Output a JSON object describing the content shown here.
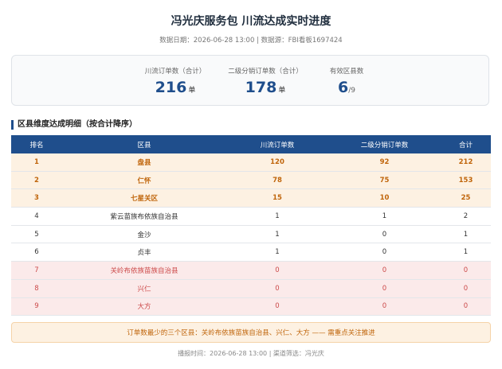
{
  "header": {
    "title": "冯光庆服务包 川流达成实时进度",
    "meta": "数据日期：2026-06-28 13:00 | 数据源：FBI看板1697424"
  },
  "summary": {
    "total_orders": {
      "label": "川流订单数（合计）",
      "value": "216",
      "unit": "单"
    },
    "sub_orders": {
      "label": "二级分销订单数（合计）",
      "value": "178",
      "unit": "单"
    },
    "districts": {
      "label": "有效区县数",
      "value": "6",
      "suffix": "/9"
    }
  },
  "section_title": "区县维度达成明细（按合计降序）",
  "table": {
    "headers": [
      "排名",
      "区县",
      "川流订单数",
      "二级分销订单数",
      "合计"
    ],
    "rows": [
      {
        "rank": "1",
        "district": "盘县",
        "orders": "120",
        "sub": "92",
        "total": "212",
        "tier": "top"
      },
      {
        "rank": "2",
        "district": "仁怀",
        "orders": "78",
        "sub": "75",
        "total": "153",
        "tier": "top"
      },
      {
        "rank": "3",
        "district": "七星关区",
        "orders": "15",
        "sub": "10",
        "total": "25",
        "tier": "top"
      },
      {
        "rank": "4",
        "district": "紫云苗族布依族自治县",
        "orders": "1",
        "sub": "1",
        "total": "2",
        "tier": "mid"
      },
      {
        "rank": "5",
        "district": "金沙",
        "orders": "1",
        "sub": "0",
        "total": "1",
        "tier": "mid"
      },
      {
        "rank": "6",
        "district": "贞丰",
        "orders": "1",
        "sub": "0",
        "total": "1",
        "tier": "mid"
      },
      {
        "rank": "7",
        "district": "关岭布依族苗族自治县",
        "orders": "0",
        "sub": "0",
        "total": "0",
        "tier": "low"
      },
      {
        "rank": "8",
        "district": "兴仁",
        "orders": "0",
        "sub": "0",
        "total": "0",
        "tier": "low"
      },
      {
        "rank": "9",
        "district": "大方",
        "orders": "0",
        "sub": "0",
        "total": "0",
        "tier": "low"
      }
    ]
  },
  "notice": "订单数最少的三个区县：关岭布依族苗族自治县、兴仁、大方 —— 需重点关注推进",
  "footer": "播报时间：2026-06-28 13:00 | 渠道筛选：冯光庆",
  "colors": {
    "header_blue": "#1f4e8c",
    "top_bg": "#fdf1e2",
    "top_text": "#c0650b",
    "low_bg": "#fbeaea",
    "low_text": "#cc4a4a"
  }
}
